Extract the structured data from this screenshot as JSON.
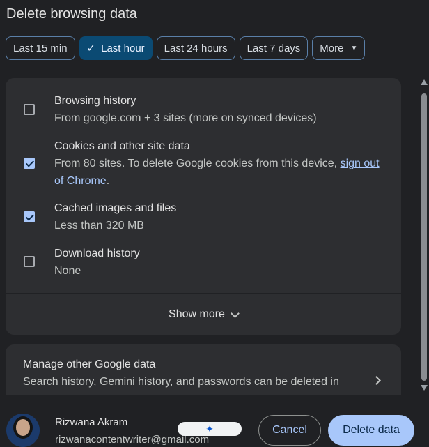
{
  "dialog": {
    "title": "Delete browsing data"
  },
  "time_ranges": [
    {
      "label": "Last 15 min",
      "selected": false
    },
    {
      "label": "Last hour",
      "selected": true
    },
    {
      "label": "Last 24 hours",
      "selected": false
    },
    {
      "label": "Last 7 days",
      "selected": false
    },
    {
      "label": "More",
      "selected": false
    }
  ],
  "items": [
    {
      "title": "Browsing history",
      "subtitle": "From google.com + 3 sites (more on synced devices)",
      "checked": false
    },
    {
      "title": "Cookies and other site data",
      "subtitle": "From 80 sites. To delete Google cookies from this device, ",
      "link": "sign out of Chrome",
      "subtitle_end": ".",
      "checked": true
    },
    {
      "title": "Cached images and files",
      "subtitle": "Less than 320 MB",
      "checked": true
    },
    {
      "title": "Download history",
      "subtitle": "None",
      "checked": false
    }
  ],
  "show_more": {
    "label": "Show more"
  },
  "manage": {
    "title": "Manage other Google data",
    "subtitle": "Search history, Gemini history, and passwords can be deleted in"
  },
  "account": {
    "name": "Rizwana Akram",
    "email": "rizwanacontentwriter@gmail.com"
  },
  "buttons": {
    "cancel": "Cancel",
    "delete": "Delete data"
  },
  "icons": [
    "check-icon",
    "caret-down-icon",
    "chevron-down-icon",
    "chevron-right-icon",
    "sparkle-icon",
    "avatar"
  ],
  "colors": {
    "accent": "#a8c7fa",
    "selected_chip": "#0b4a73",
    "surface": "#2d2e31",
    "background": "#202124"
  }
}
